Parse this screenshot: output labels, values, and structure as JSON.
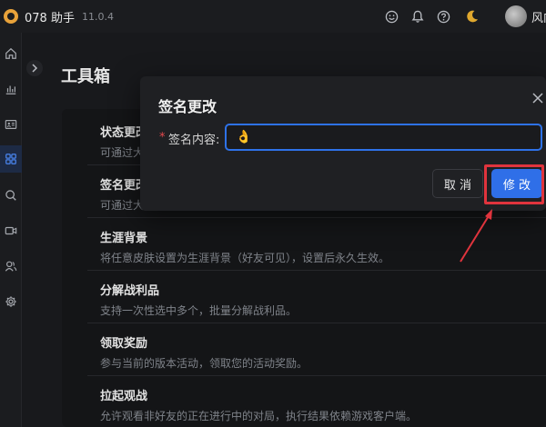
{
  "app": {
    "name": "078 助手",
    "version": "11.0.4"
  },
  "user": {
    "name": "风向"
  },
  "sidebar": {
    "items": [
      {
        "icon": "home-icon"
      },
      {
        "icon": "bar-chart-icon"
      },
      {
        "icon": "id-card-icon"
      },
      {
        "icon": "grid-icon",
        "active": true
      },
      {
        "icon": "search-icon"
      },
      {
        "icon": "video-icon"
      },
      {
        "icon": "users-icon"
      },
      {
        "icon": "gear-icon"
      }
    ]
  },
  "page": {
    "title": "工具箱"
  },
  "tools": [
    {
      "title": "状态更改",
      "desc": "可通过大"
    },
    {
      "title": "签名更改",
      "desc": "可通过大"
    },
    {
      "title": "生涯背景",
      "desc": "将任意皮肤设置为生涯背景（好友可见），设置后永久生效。"
    },
    {
      "title": "分解战利品",
      "desc": "支持一次性选中多个，批量分解战利品。"
    },
    {
      "title": "领取奖励",
      "desc": "参与当前的版本活动，领取您的活动奖励。"
    },
    {
      "title": "拉起观战",
      "desc": "允许观看非好友的正在进行中的对局，执行结果依赖游戏客户端。"
    }
  ],
  "modal": {
    "title": "签名更改",
    "required_mark": "*",
    "field_label": "签名内容:",
    "field_value": "👌",
    "cancel_label": "取 消",
    "confirm_label": "修 改"
  },
  "colors": {
    "accent": "#2f6fe8",
    "annotation": "#e0343d",
    "background": "#18191c"
  }
}
